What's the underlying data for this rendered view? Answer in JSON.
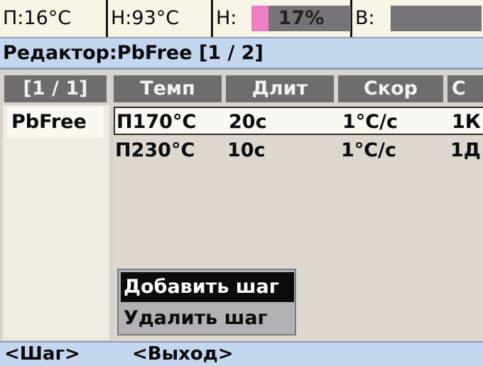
{
  "status_bar": {
    "p": "П:16°C",
    "h": "Н:93°C",
    "heater_label": "Н:",
    "heater_value": "17%",
    "heater_percent": 17,
    "b_label": "В:",
    "bar_color": "#767476",
    "heater_fill_color": "#ee7fc7"
  },
  "title": "Редактор:PbFree [1 / 2]",
  "table": {
    "headers": {
      "page": "[1 / 1]",
      "temp": "Темп",
      "dlit": "Длит",
      "skor": "Скор",
      "c": "С"
    },
    "profiles": [
      "PbFree"
    ],
    "steps": [
      {
        "temp": "П170°C",
        "dlit": "20с",
        "skor": "1°C/с",
        "c": "1К"
      },
      {
        "temp": "П230°C",
        "dlit": "10с",
        "skor": "1°C/с",
        "c": "1Д"
      }
    ]
  },
  "context_menu": {
    "items": [
      {
        "label": "Добавить шаг"
      },
      {
        "label": "Удалить шаг"
      }
    ]
  },
  "softkeys": {
    "step": "<Шаг>",
    "exit": "<Выход>"
  }
}
